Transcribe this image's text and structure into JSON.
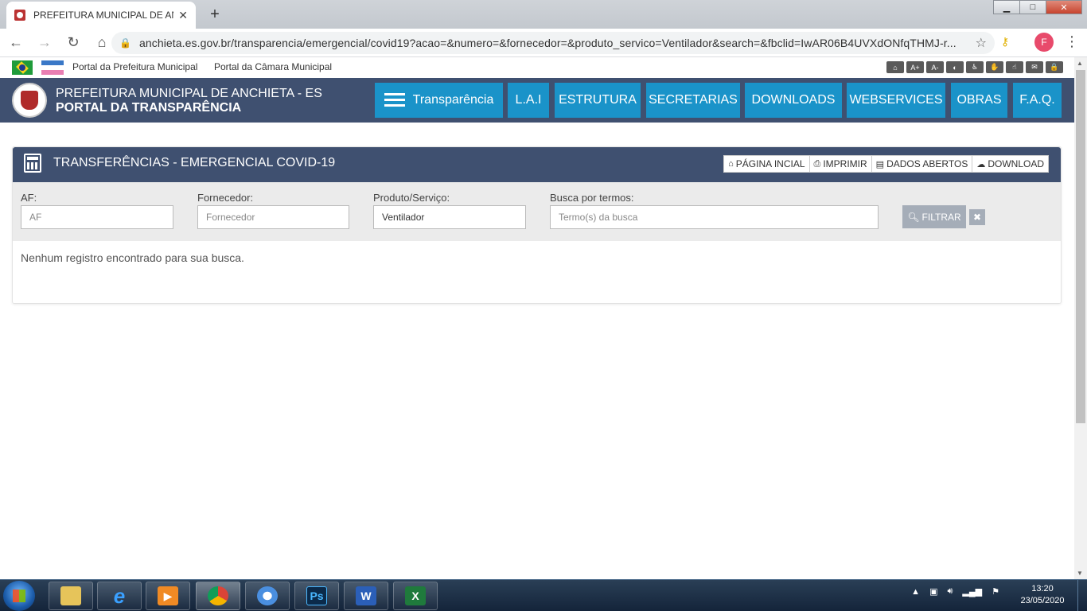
{
  "browser": {
    "tab_title": "PREFEITURA MUNICIPAL DE ANC",
    "tab_close": "✕",
    "new_tab": "+",
    "url": "anchieta.es.gov.br/transparencia/emergencial/covid19?acao=&numero=&fornecedor=&produto_servico=Ventilador&search=&fbclid=IwAR06B4UVXdONfqTHMJ-r...",
    "avatar_letter": "F",
    "win_min": "▁",
    "win_max": "□",
    "win_close": "✕"
  },
  "portal_links": {
    "prefeitura": "Portal da Prefeitura Municipal",
    "camara": "Portal da Câmara Municipal"
  },
  "accessibility_icons": [
    "⌂",
    "A+",
    "A-",
    "◐",
    "♿",
    "✋",
    "☝",
    "✉",
    "🔒"
  ],
  "header": {
    "title": "PREFEITURA MUNICIPAL DE ANCHIETA - ES",
    "subtitle": "PORTAL DA TRANSPARÊNCIA"
  },
  "nav": {
    "transparencia": "Transparência",
    "lai": "L.A.I",
    "estrutura": "ESTRUTURA",
    "secretarias": "SECRETARIAS",
    "downloads": "DOWNLOADS",
    "webservices": "WEBSERVICES",
    "obras": "OBRAS",
    "faq": "F.A.Q."
  },
  "panel": {
    "title": "TRANSFERÊNCIAS - EMERGENCIAL COVID-19",
    "actions": {
      "home": "PÁGINA INCIAL",
      "print": "IMPRIMIR",
      "open_data": "DADOS ABERTOS",
      "download": "DOWNLOAD"
    }
  },
  "filters": {
    "af_label": "AF:",
    "af_placeholder": "AF",
    "fornecedor_label": "Fornecedor:",
    "fornecedor_placeholder": "Fornecedor",
    "produto_label": "Produto/Serviço:",
    "produto_value": "Ventilador",
    "busca_label": "Busca por termos:",
    "busca_placeholder": "Termo(s) da busca",
    "filter_button": "FILTRAR",
    "clear_button": "✖"
  },
  "results": {
    "empty_message": "Nenhum registro encontrado para sua busca."
  },
  "taskbar": {
    "apps": [
      "explorer",
      "ie",
      "media",
      "chrome",
      "chromium",
      "photoshop",
      "word",
      "excel"
    ],
    "photoshop_label": "Ps",
    "word_label": "W",
    "excel_label": "X",
    "time": "13:20",
    "date": "23/05/2020"
  }
}
